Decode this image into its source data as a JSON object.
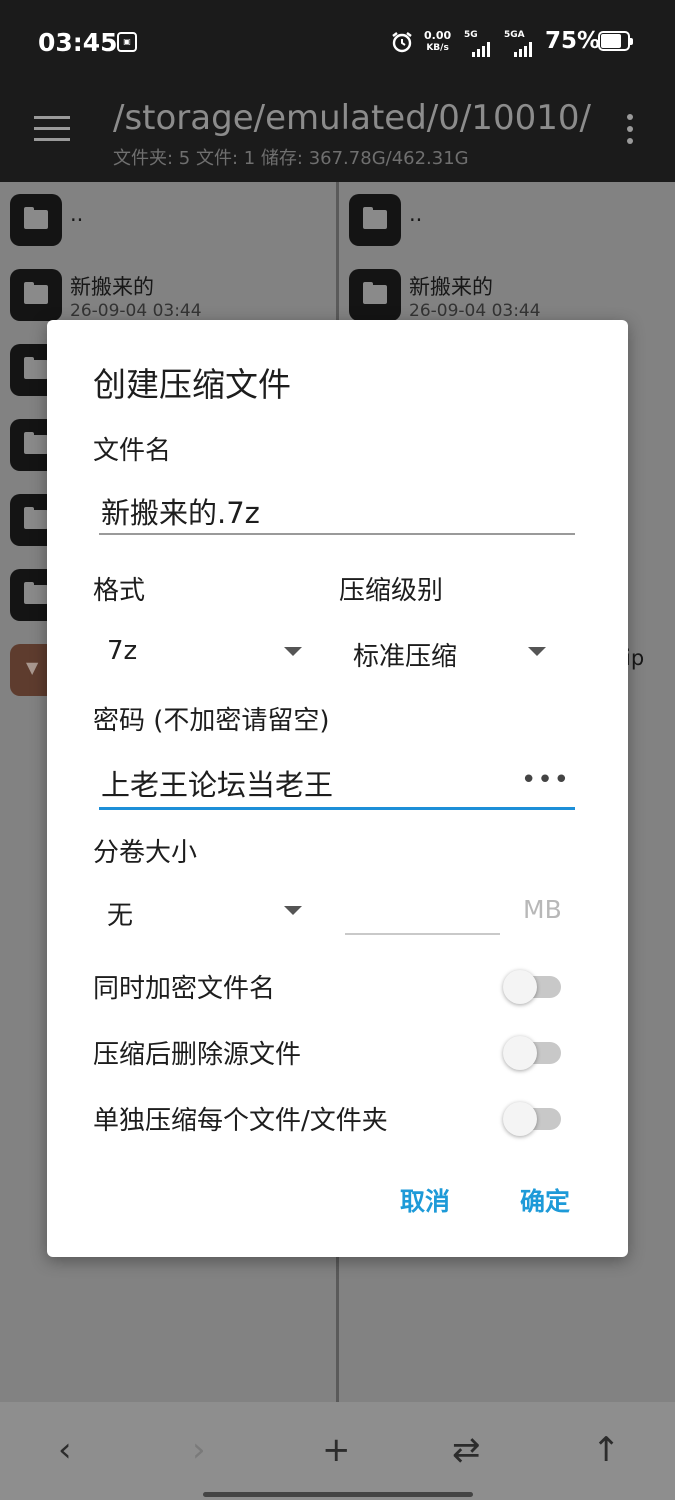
{
  "status_bar": {
    "time": "03:45",
    "net_speed_value": "0.00",
    "net_speed_unit": "KB/s",
    "sim1_label": "5G",
    "sim2_label": "5GA",
    "battery": "75%",
    "battery_level": 0.75
  },
  "app_bar": {
    "path": "/storage/emulated/0/10010/",
    "info": "文件夹: 5  文件: 1  储存: 367.78G/462.31G"
  },
  "left_pane": {
    "rows": [
      {
        "name": ".."
      },
      {
        "name": "新搬来的",
        "date": "26-09-04 03:44"
      }
    ]
  },
  "right_pane": {
    "rows": [
      {
        "name": ".."
      },
      {
        "name": "新搬来的",
        "date": "26-09-04 03:44"
      }
    ],
    "partial_text": "ip"
  },
  "dialog": {
    "title": "创建压缩文件",
    "filename_label": "文件名",
    "filename_value": "新搬来的.7z",
    "format_label": "格式",
    "format_value": "7z",
    "level_label": "压缩级别",
    "level_value": "标准压缩",
    "password_label": "密码 (不加密请留空)",
    "password_value": "上老王论坛当老王",
    "password_toggle": "•••",
    "split_label": "分卷大小",
    "split_value": "无",
    "split_unit": "MB",
    "encrypt_names_label": "同时加密文件名",
    "delete_source_label": "压缩后删除源文件",
    "separate_label": "单独压缩每个文件/文件夹",
    "cancel": "取消",
    "confirm": "确定"
  },
  "toolbar": {
    "back": "‹",
    "forward": "›",
    "add": "+",
    "swap": "⇄",
    "up": "↑"
  }
}
